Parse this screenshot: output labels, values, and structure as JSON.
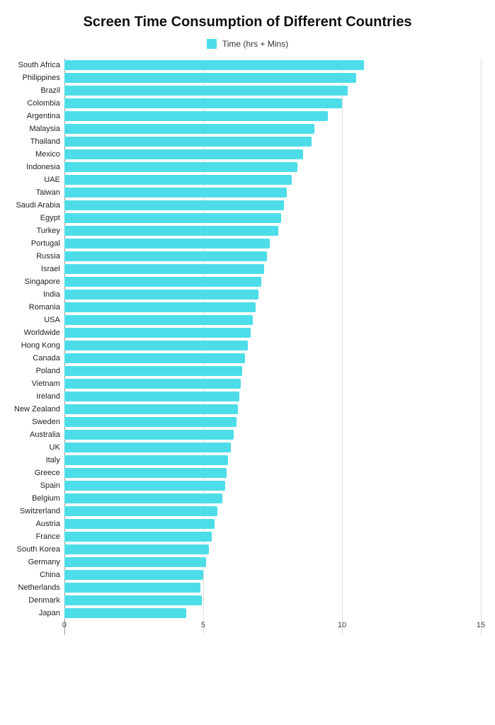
{
  "chart": {
    "title": "Screen Time Consumption of Different Countries",
    "legend_label": "Time (hrs + Mins)",
    "x_ticks": [
      0,
      5,
      10,
      15
    ],
    "max_value": 15,
    "bar_color": "#4DDDE8",
    "countries": [
      {
        "name": "South Africa",
        "value": 10.8
      },
      {
        "name": "Philippines",
        "value": 10.5
      },
      {
        "name": "Brazil",
        "value": 10.2
      },
      {
        "name": "Colombia",
        "value": 10.0
      },
      {
        "name": "Argentina",
        "value": 9.5
      },
      {
        "name": "Malaysia",
        "value": 9.0
      },
      {
        "name": "Thailand",
        "value": 8.9
      },
      {
        "name": "Mexico",
        "value": 8.6
      },
      {
        "name": "Indonesia",
        "value": 8.4
      },
      {
        "name": "UAE",
        "value": 8.2
      },
      {
        "name": "Taiwan",
        "value": 8.0
      },
      {
        "name": "Saudi Arabia",
        "value": 7.9
      },
      {
        "name": "Egypt",
        "value": 7.8
      },
      {
        "name": "Turkey",
        "value": 7.7
      },
      {
        "name": "Portugal",
        "value": 7.4
      },
      {
        "name": "Russia",
        "value": 7.3
      },
      {
        "name": "Israel",
        "value": 7.2
      },
      {
        "name": "Singapore",
        "value": 7.1
      },
      {
        "name": "India",
        "value": 7.0
      },
      {
        "name": "Romania",
        "value": 6.9
      },
      {
        "name": "USA",
        "value": 6.8
      },
      {
        "name": "Worldwide",
        "value": 6.7
      },
      {
        "name": "Hong Kong",
        "value": 6.6
      },
      {
        "name": "Canada",
        "value": 6.5
      },
      {
        "name": "Poland",
        "value": 6.4
      },
      {
        "name": "Vietnam",
        "value": 6.35
      },
      {
        "name": "Ireland",
        "value": 6.3
      },
      {
        "name": "New Zealand",
        "value": 6.25
      },
      {
        "name": "Sweden",
        "value": 6.2
      },
      {
        "name": "Australia",
        "value": 6.1
      },
      {
        "name": "UK",
        "value": 6.0
      },
      {
        "name": "Italy",
        "value": 5.9
      },
      {
        "name": "Greece",
        "value": 5.85
      },
      {
        "name": "Spain",
        "value": 5.8
      },
      {
        "name": "Belgium",
        "value": 5.7
      },
      {
        "name": "Switzerland",
        "value": 5.5
      },
      {
        "name": "Austria",
        "value": 5.4
      },
      {
        "name": "France",
        "value": 5.3
      },
      {
        "name": "South Korea",
        "value": 5.2
      },
      {
        "name": "Germany",
        "value": 5.1
      },
      {
        "name": "China",
        "value": 5.0
      },
      {
        "name": "Netherlands",
        "value": 4.9
      },
      {
        "name": "Denmark",
        "value": 4.95
      },
      {
        "name": "Japan",
        "value": 4.4
      }
    ]
  }
}
